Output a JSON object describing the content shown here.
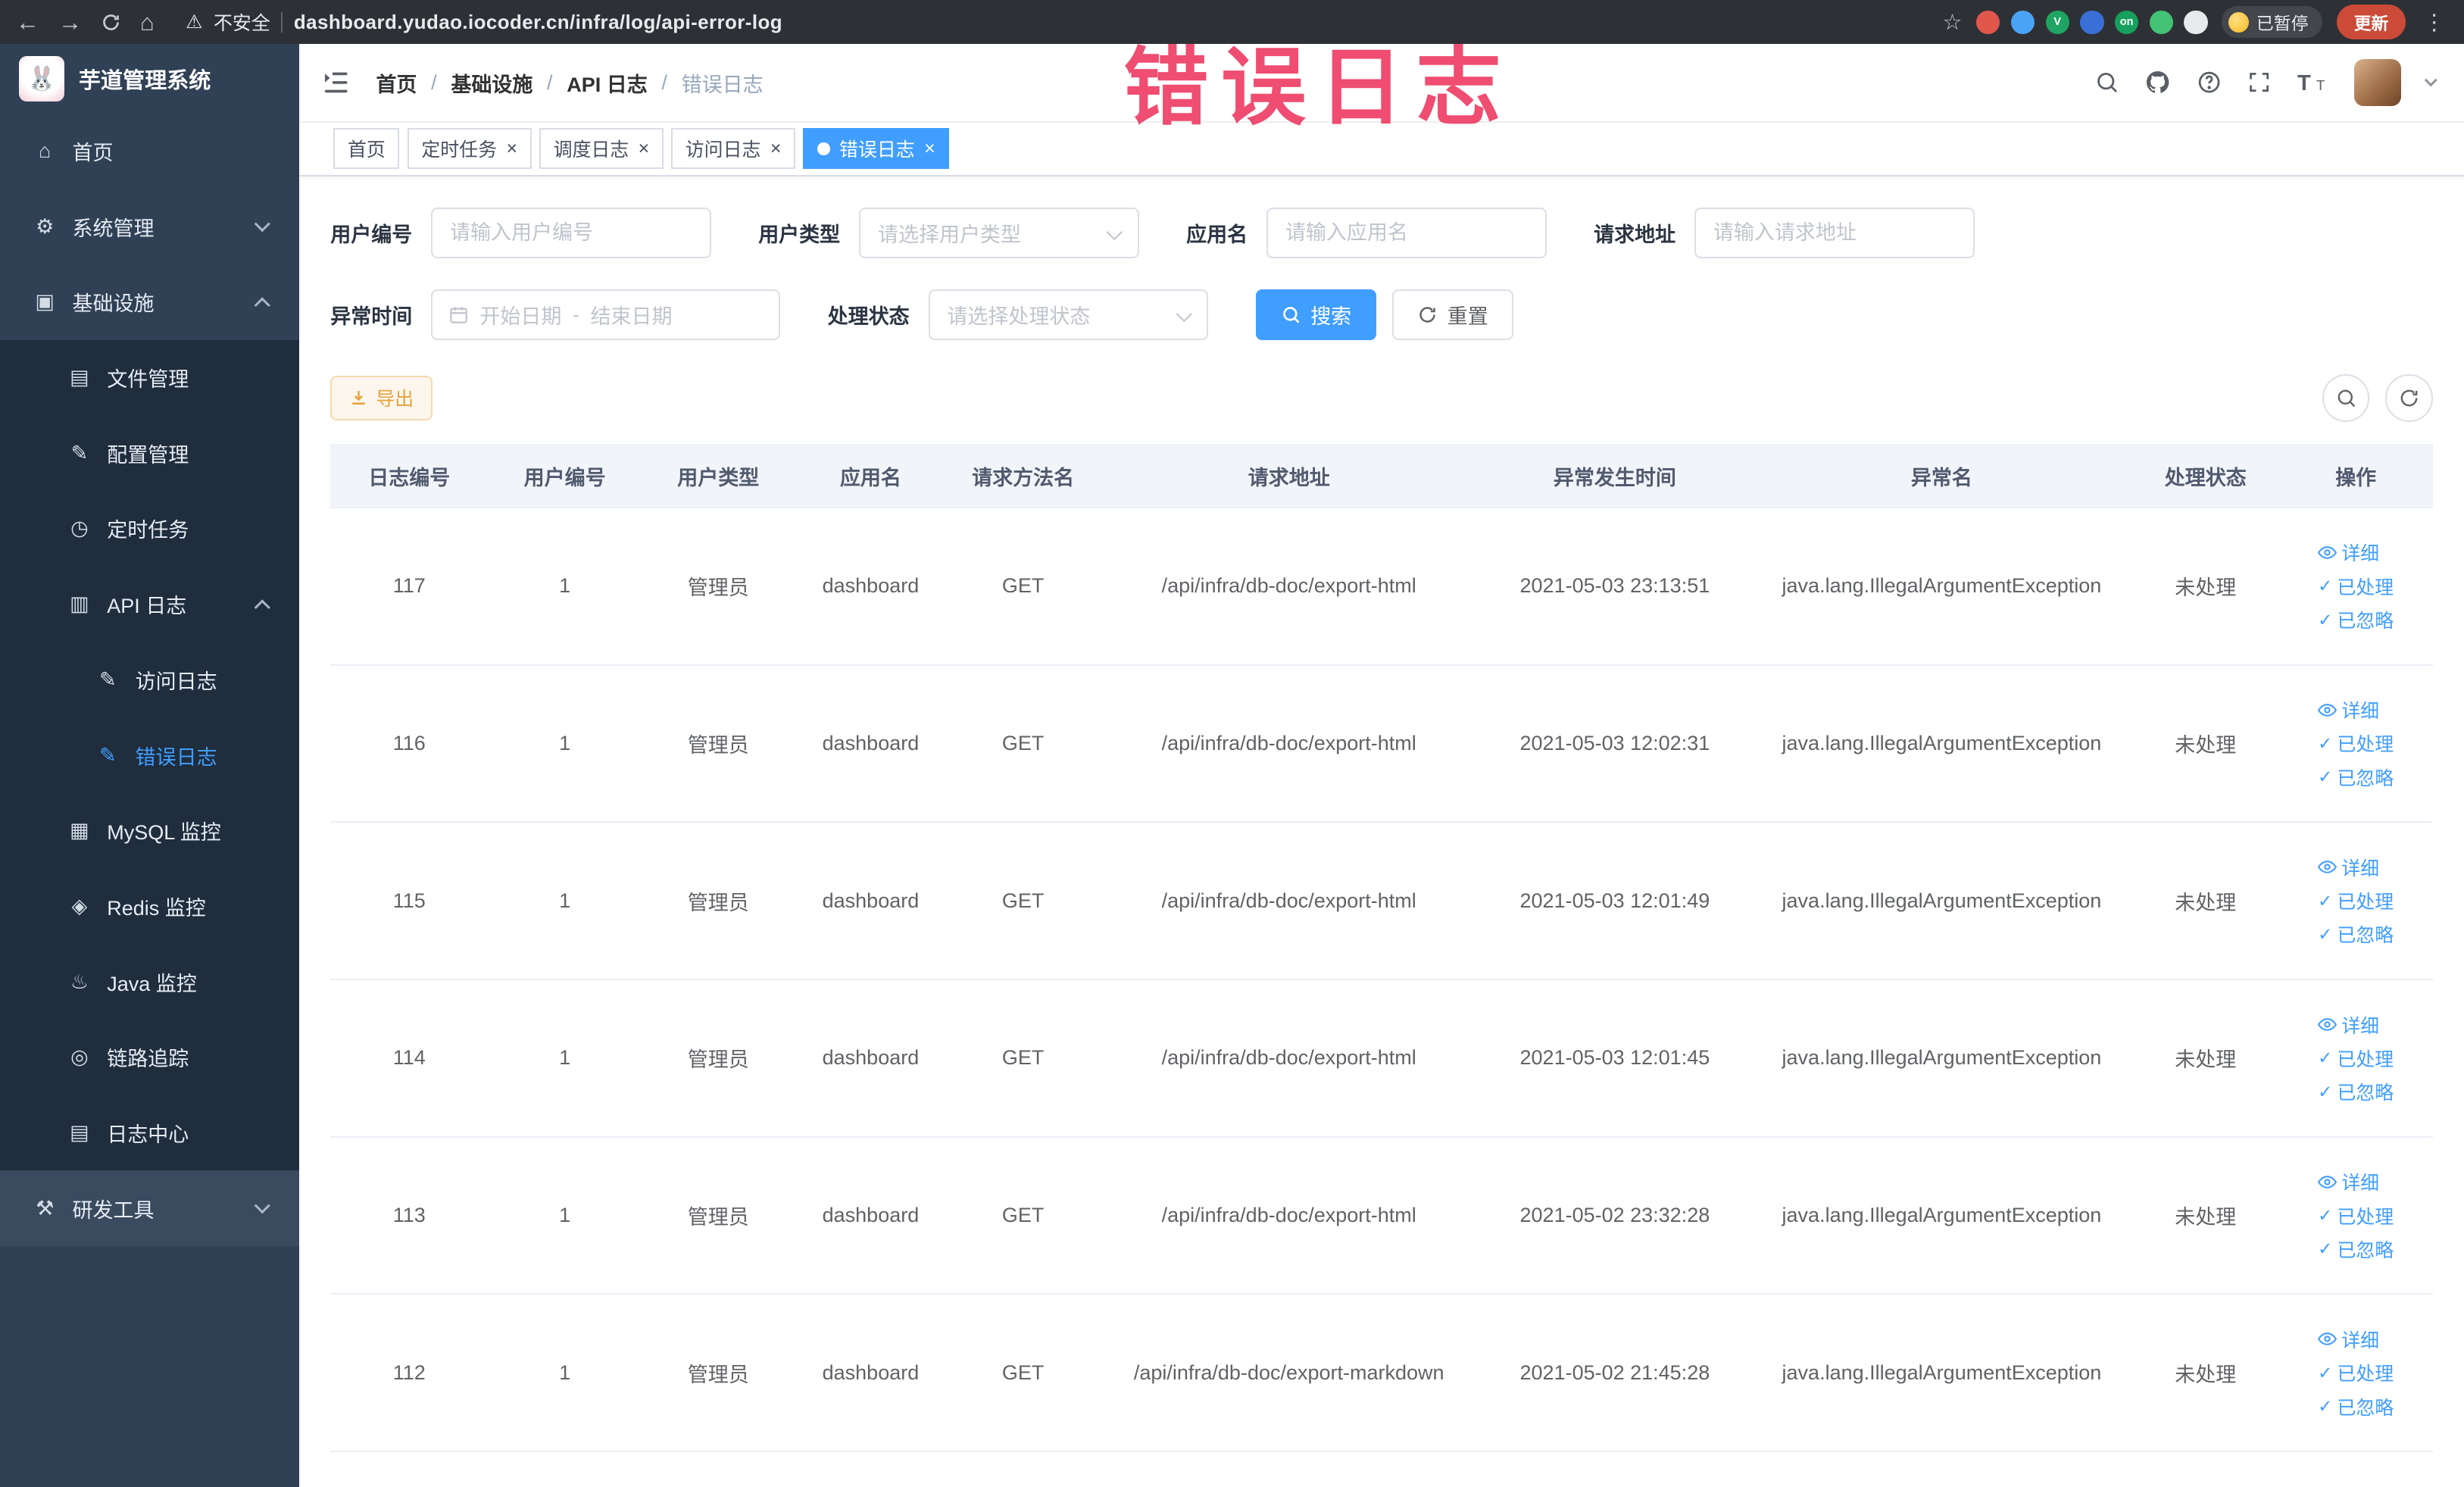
{
  "watermark": "错误日志",
  "browser": {
    "security_label": "不安全",
    "url": "dashboard.yudao.iocoder.cn/infra/log/api-error-log",
    "paused_badge": "已暂停",
    "update_button": "更新",
    "extensions": [
      {
        "color": "#e2574c",
        "label": ""
      },
      {
        "color": "#4aa3f5",
        "label": ""
      },
      {
        "color": "#1fa463",
        "label": "V"
      },
      {
        "color": "#3a6fd8",
        "label": ""
      },
      {
        "color": "#16a05d",
        "label": "on"
      },
      {
        "color": "#43c174",
        "label": ""
      },
      {
        "color": "#e9eaec",
        "label": ""
      }
    ]
  },
  "icons": {
    "home-icon": "⌂",
    "gear-icon": "⚙",
    "infra-icon": "▣",
    "file-icon": "▤",
    "config-icon": "✎",
    "timer-icon": "◷",
    "api-log-icon": "▥",
    "access-log-icon": "✎",
    "error-log-icon": "✎",
    "mysql-icon": "▦",
    "redis-icon": "◈",
    "java-icon": "♨",
    "trace-icon": "◎",
    "log-center-icon": "▤",
    "tools-icon": "⚒",
    "warning-icon": "⚠",
    "star-icon": "☆",
    "kebab-icon": "⋮",
    "back-icon": "←",
    "forward-icon": "→",
    "browser-home-icon": "⌂",
    "check-icon": "✓"
  },
  "sidebar": {
    "title": "芋道管理系统",
    "items": [
      {
        "label": "首页",
        "icon": "home-icon",
        "level": 1
      },
      {
        "label": "系统管理",
        "icon": "gear-icon",
        "level": 1,
        "chevron": "down"
      },
      {
        "label": "基础设施",
        "icon": "infra-icon",
        "level": 1,
        "chevron": "up"
      },
      {
        "label": "文件管理",
        "icon": "file-icon",
        "level": 2
      },
      {
        "label": "配置管理",
        "icon": "config-icon",
        "level": 2
      },
      {
        "label": "定时任务",
        "icon": "timer-icon",
        "level": 2
      },
      {
        "label": "API 日志",
        "icon": "api-log-icon",
        "level": 2,
        "chevron": "up"
      },
      {
        "label": "访问日志",
        "icon": "access-log-icon",
        "level": 3
      },
      {
        "label": "错误日志",
        "icon": "error-log-icon",
        "level": 3,
        "active": true
      },
      {
        "label": "MySQL 监控",
        "icon": "mysql-icon",
        "level": 2
      },
      {
        "label": "Redis 监控",
        "icon": "redis-icon",
        "level": 2
      },
      {
        "label": "Java 监控",
        "icon": "java-icon",
        "level": 2
      },
      {
        "label": "链路追踪",
        "icon": "trace-icon",
        "level": 2
      },
      {
        "label": "日志中心",
        "icon": "log-center-icon",
        "level": 2
      },
      {
        "label": "研发工具",
        "icon": "tools-icon",
        "level": 1,
        "chevron": "down",
        "highlight": true
      }
    ]
  },
  "header": {
    "breadcrumb": [
      "首页",
      "基础设施",
      "API 日志",
      "错误日志"
    ]
  },
  "tabs": [
    {
      "label": "首页",
      "closable": false,
      "active": false
    },
    {
      "label": "定时任务",
      "closable": true,
      "active": false
    },
    {
      "label": "调度日志",
      "closable": true,
      "active": false
    },
    {
      "label": "访问日志",
      "closable": true,
      "active": false
    },
    {
      "label": "错误日志",
      "closable": true,
      "active": true
    }
  ],
  "filters": {
    "user_id": {
      "label": "用户编号",
      "placeholder": "请输入用户编号"
    },
    "user_type": {
      "label": "用户类型",
      "placeholder": "请选择用户类型"
    },
    "app_name": {
      "label": "应用名",
      "placeholder": "请输入应用名"
    },
    "request_url": {
      "label": "请求地址",
      "placeholder": "请输入请求地址"
    },
    "exception_time": {
      "label": "异常时间",
      "start_placeholder": "开始日期",
      "separator": "-",
      "end_placeholder": "结束日期"
    },
    "process_status": {
      "label": "处理状态",
      "placeholder": "请选择处理状态"
    },
    "search_button": "搜索",
    "reset_button": "重置"
  },
  "toolbar": {
    "export_button": "导出"
  },
  "table": {
    "columns": [
      "日志编号",
      "用户编号",
      "用户类型",
      "应用名",
      "请求方法名",
      "请求地址",
      "异常发生时间",
      "异常名",
      "处理状态",
      "操作"
    ],
    "actions": [
      {
        "label": "详细",
        "icon": "eye-icon"
      },
      {
        "label": "已处理",
        "icon": "check-icon"
      },
      {
        "label": "已忽略",
        "icon": "check-icon"
      }
    ],
    "rows": [
      {
        "log_id": "117",
        "user_id": "1",
        "user_type": "管理员",
        "app_name": "dashboard",
        "method": "GET",
        "request_url": "/api/infra/db-doc/export-html",
        "time": "2021-05-03 23:13:51",
        "exception": "java.lang.IllegalArgumentException",
        "status": "未处理"
      },
      {
        "log_id": "116",
        "user_id": "1",
        "user_type": "管理员",
        "app_name": "dashboard",
        "method": "GET",
        "request_url": "/api/infra/db-doc/export-html",
        "time": "2021-05-03 12:02:31",
        "exception": "java.lang.IllegalArgumentException",
        "status": "未处理"
      },
      {
        "log_id": "115",
        "user_id": "1",
        "user_type": "管理员",
        "app_name": "dashboard",
        "method": "GET",
        "request_url": "/api/infra/db-doc/export-html",
        "time": "2021-05-03 12:01:49",
        "exception": "java.lang.IllegalArgumentException",
        "status": "未处理"
      },
      {
        "log_id": "114",
        "user_id": "1",
        "user_type": "管理员",
        "app_name": "dashboard",
        "method": "GET",
        "request_url": "/api/infra/db-doc/export-html",
        "time": "2021-05-03 12:01:45",
        "exception": "java.lang.IllegalArgumentException",
        "status": "未处理"
      },
      {
        "log_id": "113",
        "user_id": "1",
        "user_type": "管理员",
        "app_name": "dashboard",
        "method": "GET",
        "request_url": "/api/infra/db-doc/export-html",
        "time": "2021-05-02 23:32:28",
        "exception": "java.lang.IllegalArgumentException",
        "status": "未处理"
      },
      {
        "log_id": "112",
        "user_id": "1",
        "user_type": "管理员",
        "app_name": "dashboard",
        "method": "GET",
        "request_url": "/api/infra/db-doc/export-markdown",
        "time": "2021-05-02 21:45:28",
        "exception": "java.lang.IllegalArgumentException",
        "status": "未处理"
      }
    ]
  }
}
